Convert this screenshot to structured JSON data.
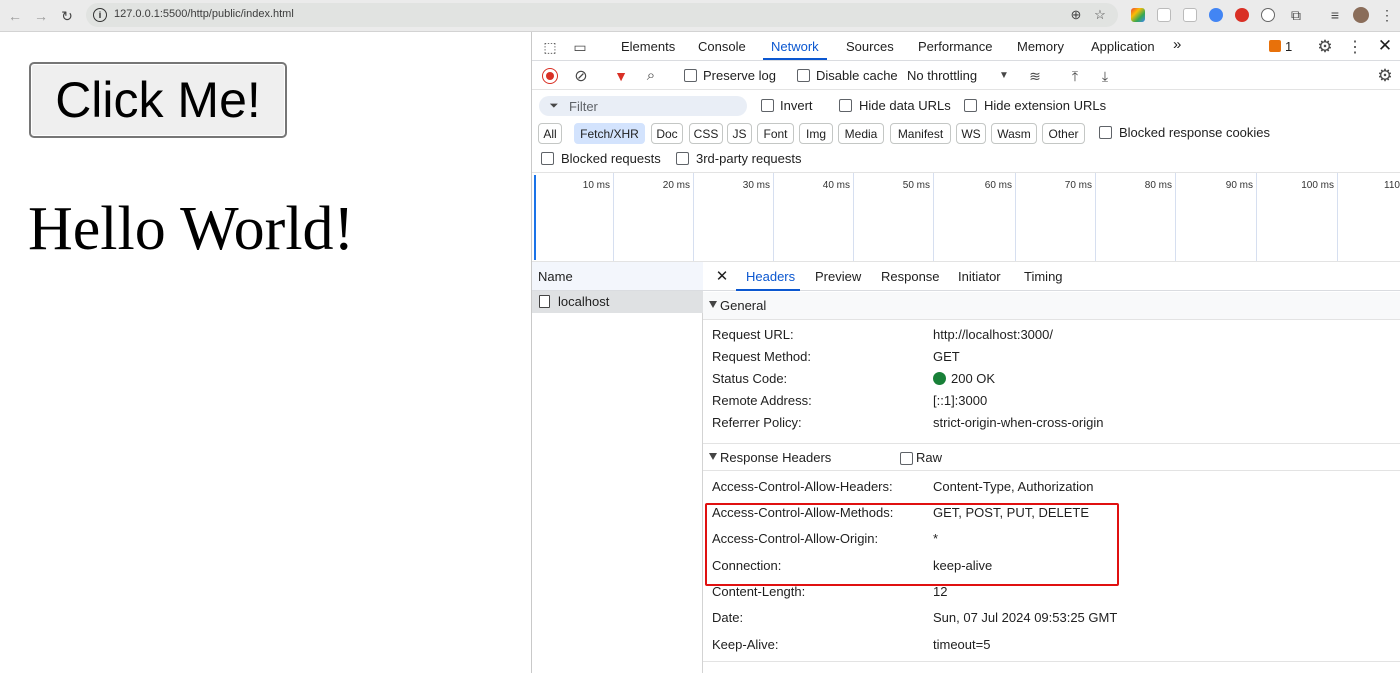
{
  "browser": {
    "url": "127.0.0.1:5500/http/public/index.html",
    "nav_icons": [
      "back-arrow-icon",
      "forward-arrow-icon",
      "reload-icon"
    ]
  },
  "page": {
    "button_label": "Click Me!",
    "heading": "Hello World!"
  },
  "devtools": {
    "tabs": [
      "Elements",
      "Console",
      "Network",
      "Sources",
      "Performance",
      "Memory",
      "Application"
    ],
    "active_tab": "Network",
    "more_tabs": "»",
    "issues_count": "1",
    "toolbar": {
      "preserve_log": "Preserve log",
      "disable_cache": "Disable cache",
      "throttling": "No throttling"
    },
    "filter": {
      "placeholder": "Filter",
      "invert": "Invert",
      "hide_data_urls": "Hide data URLs",
      "hide_extension_urls": "Hide extension URLs",
      "blocked_response_cookies": "Blocked response cookies",
      "blocked_requests": "Blocked requests",
      "third_party_requests": "3rd-party requests"
    },
    "type_filters": [
      "All",
      "Fetch/XHR",
      "Doc",
      "CSS",
      "JS",
      "Font",
      "Img",
      "Media",
      "Manifest",
      "WS",
      "Wasm",
      "Other"
    ],
    "active_type_filter": "Fetch/XHR",
    "timeline_ticks": [
      "10 ms",
      "20 ms",
      "30 ms",
      "40 ms",
      "50 ms",
      "60 ms",
      "70 ms",
      "80 ms",
      "90 ms",
      "100 ms",
      "110"
    ],
    "requests": {
      "name_header": "Name",
      "rows": [
        "localhost"
      ]
    },
    "details": {
      "tabs": [
        "Headers",
        "Preview",
        "Response",
        "Initiator",
        "Timing"
      ],
      "active_tab": "Headers",
      "general": {
        "title": "General",
        "rows": [
          {
            "name": "Request URL:",
            "value": "http://localhost:3000/"
          },
          {
            "name": "Request Method:",
            "value": "GET"
          },
          {
            "name": "Status Code:",
            "value": "200 OK"
          },
          {
            "name": "Remote Address:",
            "value": "[::1]:3000"
          },
          {
            "name": "Referrer Policy:",
            "value": "strict-origin-when-cross-origin"
          }
        ]
      },
      "response_headers": {
        "title": "Response Headers",
        "raw_label": "Raw",
        "rows": [
          {
            "name": "Access-Control-Allow-Headers:",
            "value": "Content-Type, Authorization"
          },
          {
            "name": "Access-Control-Allow-Methods:",
            "value": "GET, POST, PUT, DELETE"
          },
          {
            "name": "Access-Control-Allow-Origin:",
            "value": "*"
          },
          {
            "name": "Connection:",
            "value": "keep-alive"
          },
          {
            "name": "Content-Length:",
            "value": "12"
          },
          {
            "name": "Date:",
            "value": "Sun, 07 Jul 2024 09:53:25 GMT"
          },
          {
            "name": "Keep-Alive:",
            "value": "timeout=5"
          }
        ]
      }
    },
    "colors": {
      "accent": "#0b57d0",
      "record": "#d93025",
      "filter_funnel": "#d93025",
      "status_ok": "#188038",
      "highlight_box": "#e01010"
    }
  }
}
